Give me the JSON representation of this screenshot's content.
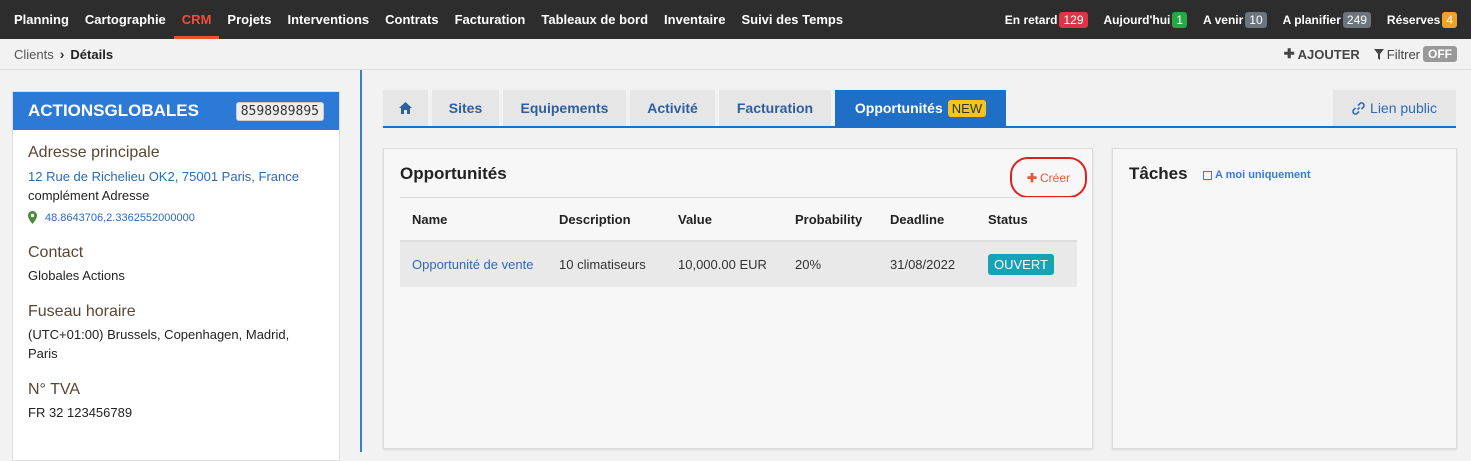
{
  "nav": {
    "items": [
      {
        "label": "Planning"
      },
      {
        "label": "Cartographie"
      },
      {
        "label": "CRM"
      },
      {
        "label": "Projets"
      },
      {
        "label": "Interventions"
      },
      {
        "label": "Contrats"
      },
      {
        "label": "Facturation"
      },
      {
        "label": "Tableaux de bord"
      },
      {
        "label": "Inventaire"
      },
      {
        "label": "Suivi des Temps"
      }
    ],
    "active": "CRM",
    "stats": [
      {
        "label": "En retard",
        "count": "129",
        "color": "#dc3545"
      },
      {
        "label": "Aujourd'hui",
        "count": "1",
        "color": "#28a745"
      },
      {
        "label": "A venir",
        "count": "10",
        "color": "#6c757d"
      },
      {
        "label": "A planifier",
        "count": "249",
        "color": "#6c757d"
      },
      {
        "label": "Réserves",
        "count": "4",
        "color": "#f0a030"
      }
    ]
  },
  "breadcrumb": {
    "parent": "Clients",
    "current": "Détails"
  },
  "actions": {
    "add": "AJOUTER",
    "filter": "Filtrer",
    "filter_state": "OFF"
  },
  "client": {
    "name": "ACTIONSGLOBALES",
    "code": "8598989895",
    "address_label": "Adresse principale",
    "address": "12 Rue de Richelieu OK2, 75001 Paris, France",
    "address_complement": "complément Adresse",
    "coordinates": "48.8643706,2.3362552000000",
    "contact_label": "Contact",
    "contact": "Globales Actions",
    "timezone_label": "Fuseau horaire",
    "timezone": "(UTC+01:00) Brussels, Copenhagen, Madrid, Paris",
    "vat_label": "N° TVA",
    "vat": "FR 32 123456789"
  },
  "tabs": {
    "items": [
      {
        "label": "Sites"
      },
      {
        "label": "Equipements"
      },
      {
        "label": "Activité"
      },
      {
        "label": "Facturation"
      },
      {
        "label": "Opportunités",
        "badge": "NEW"
      }
    ],
    "public_link": "Lien public"
  },
  "opportunities": {
    "title": "Opportunités",
    "create": "Créer",
    "columns": [
      "Name",
      "Description",
      "Value",
      "Probability",
      "Deadline",
      "Status"
    ],
    "rows": [
      {
        "name": "Opportunité de vente",
        "description": "10 climatiseurs",
        "value": "10,000.00 EUR",
        "probability": "20%",
        "deadline": "31/08/2022",
        "status": "OUVERT"
      }
    ]
  },
  "tasks": {
    "title": "Tâches",
    "filter_label": "A moi uniquement"
  }
}
